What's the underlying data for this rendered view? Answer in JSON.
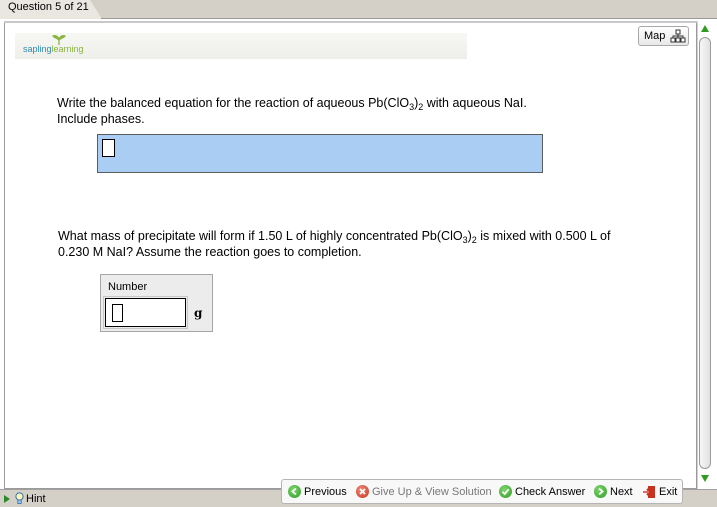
{
  "tab": {
    "label": "Question 5 of 21"
  },
  "brand": {
    "part1": "sapling",
    "part2": "learning"
  },
  "map": {
    "label": "Map"
  },
  "question1": {
    "text_a": "Write the balanced equation for the reaction of aqueous Pb(ClO",
    "sub_a": "3",
    "text_b": ")",
    "sub_b": "2",
    "text_c": " with aqueous NaI.",
    "line2": "Include phases."
  },
  "question2": {
    "text_a": "What mass of precipitate will form if 1.50 L of highly concentrated Pb(ClO",
    "sub_a": "3",
    "text_b": ")",
    "sub_b": "2",
    "text_c": " is mixed with 0.500 L of",
    "line2": "0.230 M NaI? Assume the reaction goes to completion."
  },
  "number_panel": {
    "label": "Number",
    "value": "",
    "unit": "g"
  },
  "footer": {
    "hint": "Hint",
    "previous": "Previous",
    "give_up": "Give Up & View Solution",
    "check": "Check Answer",
    "next": "Next",
    "exit": "Exit"
  },
  "colors": {
    "answer_box": "#a9cdf3",
    "accent_green": "#2f9b22",
    "accent_red": "#c8311e"
  }
}
